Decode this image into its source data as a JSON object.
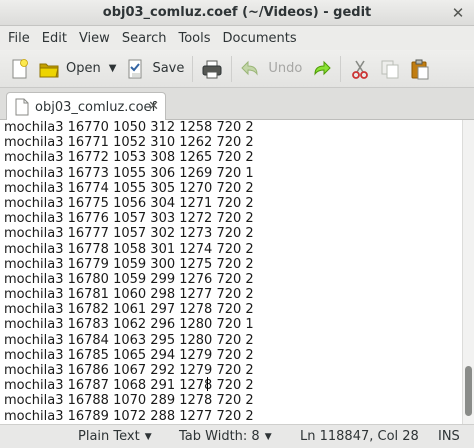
{
  "window": {
    "title": "obj03_comluz.coef (~/Videos) - gedit"
  },
  "menu": [
    "File",
    "Edit",
    "View",
    "Search",
    "Tools",
    "Documents"
  ],
  "toolbar": {
    "open_label": "Open",
    "save_label": "Save",
    "undo_label": "Undo"
  },
  "tab": {
    "title": "obj03_comluz.coef"
  },
  "editor": {
    "lines": [
      "mochila3 16770 1050 312 1258 720 2",
      "mochila3 16771 1052 310 1262 720 2",
      "mochila3 16772 1053 308 1265 720 2",
      "mochila3 16773 1055 306 1269 720 1",
      "mochila3 16774 1055 305 1270 720 2",
      "mochila3 16775 1056 304 1271 720 2",
      "mochila3 16776 1057 303 1272 720 2",
      "mochila3 16777 1057 302 1273 720 2",
      "mochila3 16778 1058 301 1274 720 2",
      "mochila3 16779 1059 300 1275 720 2",
      "mochila3 16780 1059 299 1276 720 2",
      "mochila3 16781 1060 298 1277 720 2",
      "mochila3 16782 1061 297 1278 720 2",
      "mochila3 16783 1062 296 1280 720 1",
      "mochila3 16784 1063 295 1280 720 2",
      "mochila3 16785 1065 294 1279 720 2",
      "mochila3 16786 1067 292 1279 720 2",
      "mochila3 16787 1068 291 1278 720 2",
      "mochila3 16788 1070 289 1278 720 2",
      "mochila3 16789 1072 288 1277 720 2"
    ]
  },
  "status": {
    "language": "Plain Text",
    "tab_width": "Tab Width:  8",
    "position": "Ln 118847, Col 28",
    "mode": "INS"
  },
  "colors": {
    "accent_blue": "#3465a4",
    "folder_yellow": "#edd400",
    "scissors_red": "#cc3333"
  },
  "icons": [
    "new-document-icon",
    "open-folder-icon",
    "save-icon",
    "print-icon",
    "undo-icon",
    "redo-icon",
    "cut-icon",
    "copy-icon",
    "paste-icon",
    "document-icon",
    "close-icon"
  ]
}
